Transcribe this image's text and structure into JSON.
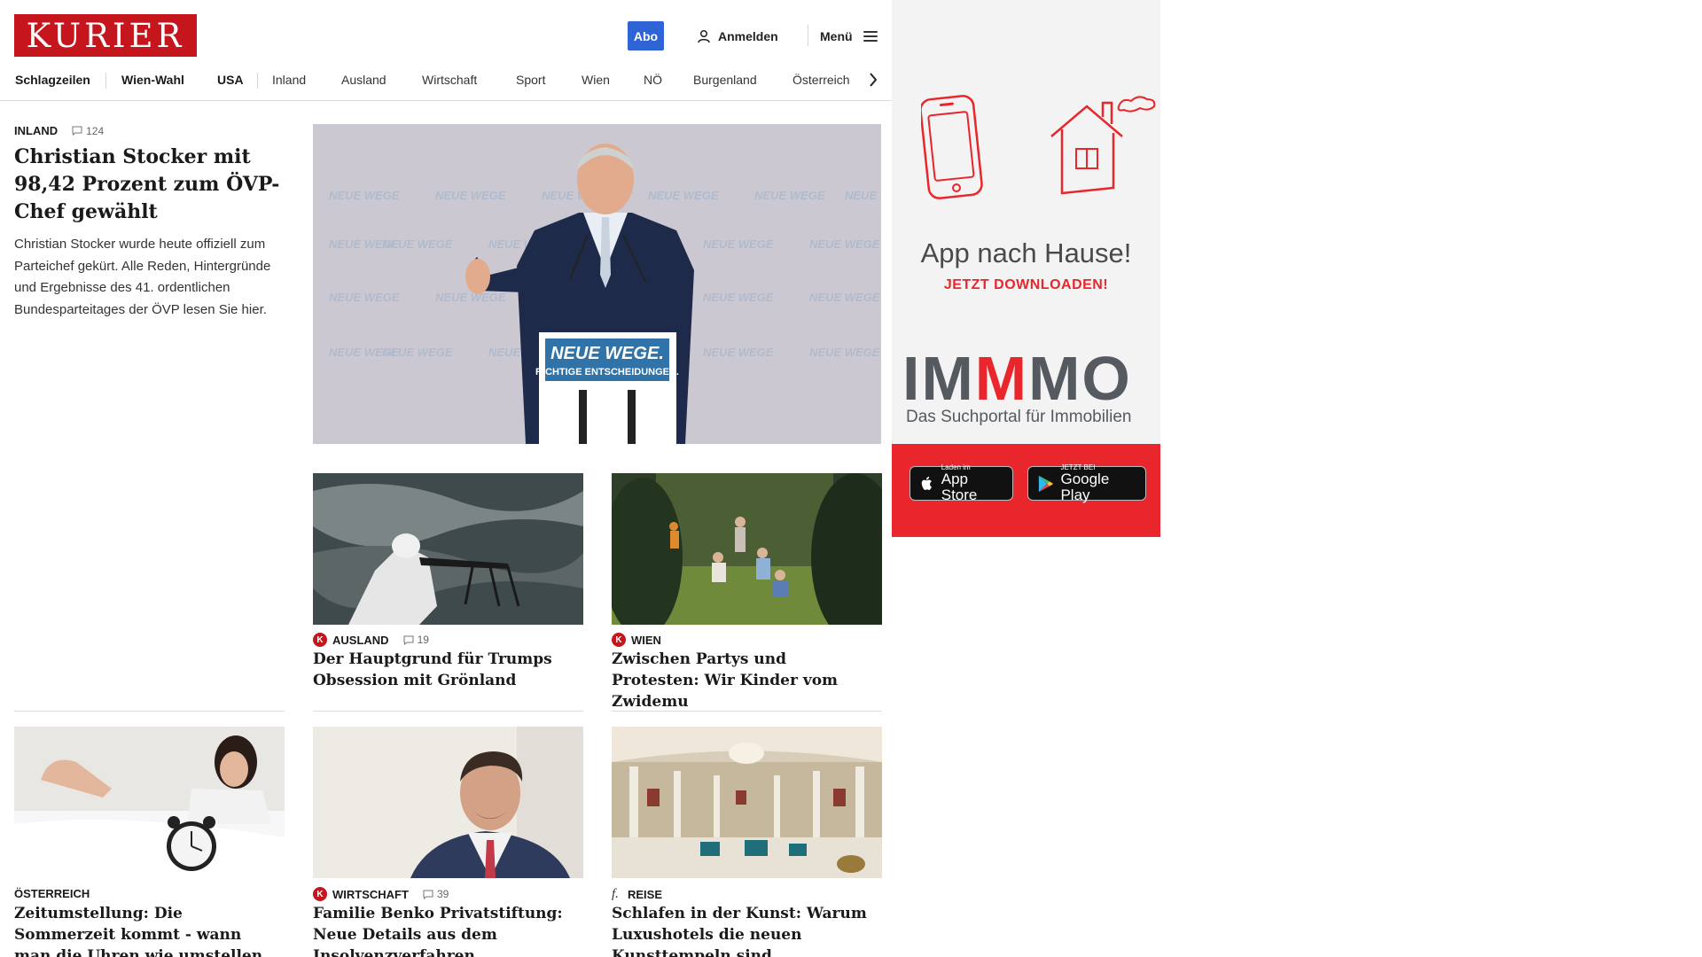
{
  "header": {
    "logo_text": "KURIER",
    "abo_label": "Abo",
    "login_label": "Anmelden",
    "menu_label": "Menü"
  },
  "nav": {
    "items": [
      "Schlagzeilen",
      "Wien-Wahl",
      "USA",
      "Inland",
      "Ausland",
      "Wirtschaft",
      "Sport",
      "Wien",
      "NÖ",
      "Burgenland",
      "Österreich"
    ]
  },
  "lead": {
    "kicker": "INLAND",
    "comments": "124",
    "title": "Christian Stocker mit 98,42 Prozent zum ÖVP-Chef gewählt",
    "teaser": "Christian Stocker wurde heute offiziell zum Parteichef gekürt. Alle Reden, Hintergründe und Ergebnisse des 41. ordentlichen Bundesparteitages der ÖVP lesen Sie hier.",
    "lectern_line1": "NEUE WEGE.",
    "lectern_line2": "RICHTIGE ENTSCHEIDUNGEN.",
    "backdrop_text": "NEUE WEGE"
  },
  "cards": [
    {
      "kicker": "AUSLAND",
      "badge": "K",
      "comments": "19",
      "title": "Der Hauptgrund für Trumps Obsession mit Grönland"
    },
    {
      "kicker": "WIEN",
      "badge": "K",
      "comments": "",
      "title": "Zwischen Partys und Protesten: Wir Kinder vom Zwidemu"
    },
    {
      "kicker": "ÖSTERREICH",
      "badge": "",
      "comments": "",
      "title": "Zeitumstellung: Die Sommerzeit kommt - wann man die Uhren wie umstellen muss"
    },
    {
      "kicker": "WIRTSCHAFT",
      "badge": "K",
      "comments": "39",
      "title": "Familie Benko Privatstiftung: Neue Details aus dem Insolvenzverfahren"
    },
    {
      "kicker": "REISE",
      "badge": "f.",
      "comments": "",
      "title": "Schlafen in der Kunst: Warum Luxushotels die neuen Kunsttempeln sind"
    }
  ],
  "ad": {
    "title": "App nach Hause!",
    "subtitle": "JETZT DOWNLOADEN!",
    "brand_1": "IM",
    "brand_2": "M",
    "brand_3": "MO",
    "brand_sub": "Das Suchportal für Immobilien",
    "appstore_small": "Laden im",
    "appstore_big": "App Store",
    "googleplay_small": "JETZT BEI",
    "googleplay_big": "Google Play"
  },
  "colors": {
    "brand_red": "#c4161c",
    "abo_blue": "#2e64d6",
    "ad_red": "#e8262c"
  }
}
